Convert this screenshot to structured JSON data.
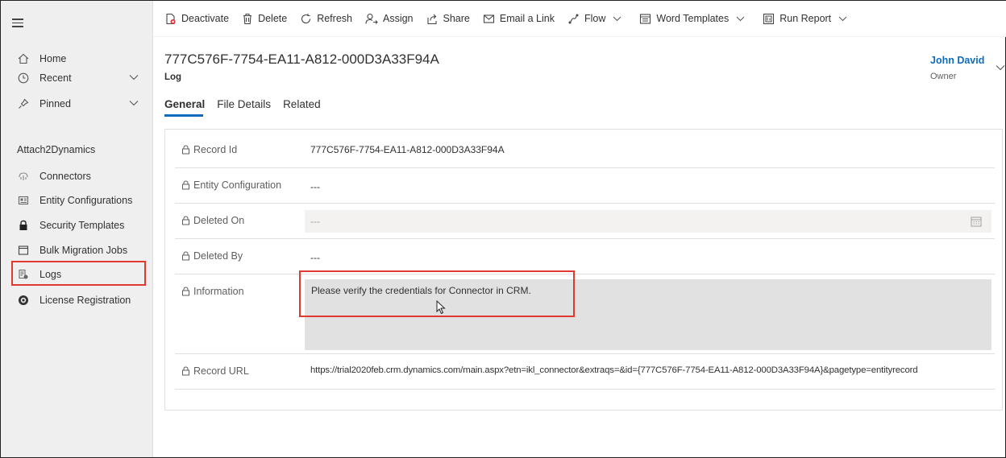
{
  "sidebar": {
    "nav": [
      {
        "label": "Home",
        "icon": "home-icon"
      },
      {
        "label": "Recent",
        "icon": "clock-icon"
      },
      {
        "label": "Pinned",
        "icon": "pin-icon"
      }
    ],
    "section_title": "Attach2Dynamics",
    "items": [
      {
        "label": "Connectors",
        "icon": "connector-icon"
      },
      {
        "label": "Entity Configurations",
        "icon": "entity-config-icon"
      },
      {
        "label": "Security Templates",
        "icon": "lock-icon"
      },
      {
        "label": "Bulk Migration Jobs",
        "icon": "window-icon"
      },
      {
        "label": "Logs",
        "icon": "log-icon"
      },
      {
        "label": "License Registration",
        "icon": "license-icon"
      }
    ],
    "selected": "Logs"
  },
  "toolbar": {
    "deactivate": "Deactivate",
    "delete": "Delete",
    "refresh": "Refresh",
    "assign": "Assign",
    "share": "Share",
    "email_link": "Email a Link",
    "flow": "Flow",
    "word_templates": "Word Templates",
    "run_report": "Run Report"
  },
  "record": {
    "title": "777C576F-7754-EA11-A812-000D3A33F94A",
    "entity": "Log",
    "owner_name": "John David",
    "owner_label": "Owner"
  },
  "tabs": [
    {
      "label": "General",
      "active": true
    },
    {
      "label": "File Details",
      "active": false
    },
    {
      "label": "Related",
      "active": false
    }
  ],
  "fields": {
    "record_id": {
      "label": "Record Id",
      "value": "777C576F-7754-EA11-A812-000D3A33F94A"
    },
    "entity_configuration": {
      "label": "Entity Configuration",
      "value": "---"
    },
    "deleted_on": {
      "label": "Deleted On",
      "value": "---"
    },
    "deleted_by": {
      "label": "Deleted By",
      "value": "---"
    },
    "information": {
      "label": "Information",
      "value": "Please verify the credentials for Connector in CRM."
    },
    "record_url": {
      "label": "Record URL",
      "value": "https://trial2020feb.crm.dynamics.com/main.aspx?etn=ikl_connector&extraqs=&id={777C576F-7754-EA11-A812-000D3A33F94A}&pagetype=entityrecord"
    }
  },
  "colors": {
    "accent": "#0f6cbd",
    "highlight": "#e0392f",
    "sidebar_bg": "#efefef"
  }
}
